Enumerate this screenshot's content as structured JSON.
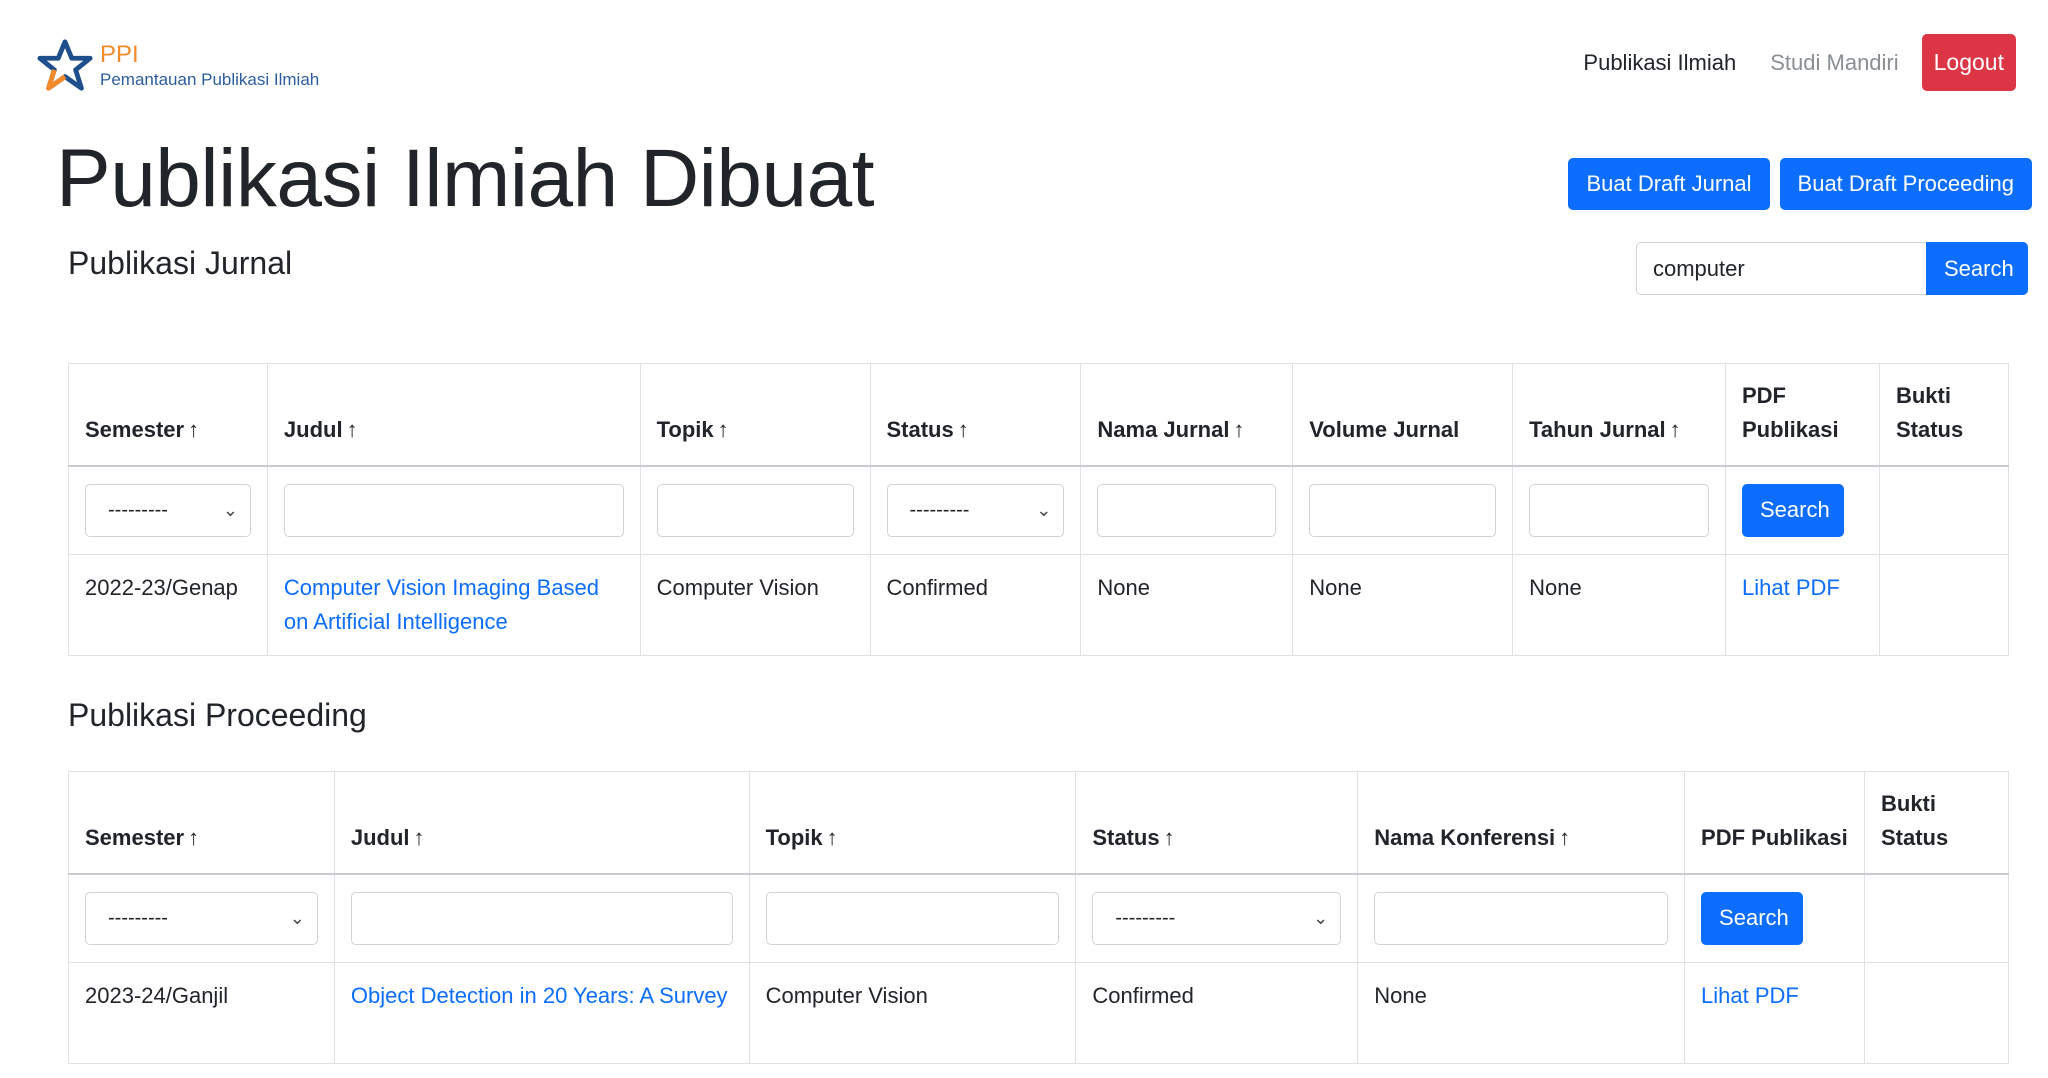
{
  "navbar": {
    "brand_short": "PPI",
    "brand_full": "Pemantauan Publikasi Ilmiah",
    "links": [
      "Publikasi Ilmiah",
      "Studi Mandiri"
    ],
    "logout_label": "Logout"
  },
  "page": {
    "title": "Publikasi Ilmiah Dibuat",
    "btn_draft_jurnal": "Buat Draft Jurnal",
    "btn_draft_proceeding": "Buat Draft Proceeding"
  },
  "search": {
    "value": "computer",
    "button_label": "Search"
  },
  "jurnal": {
    "section_title": "Publikasi Jurnal",
    "headers": [
      "Semester",
      "Judul",
      "Topik",
      "Status",
      "Nama Jurnal",
      "Volume Jurnal",
      "Tahun Jurnal",
      "PDF Publikasi",
      "Bukti Status"
    ],
    "sort_arrow": "↑",
    "filter": {
      "select_placeholder": "---------",
      "status_placeholder": "---------",
      "button_label": "Search"
    },
    "rows": [
      {
        "semester": "2022-23/Genap",
        "judul": "Computer Vision Imaging Based on Artificial Intelligence",
        "topik": "Computer Vision",
        "status": "Confirmed",
        "nama_jurnal": "None",
        "volume_jurnal": "None",
        "tahun_jurnal": "None",
        "pdf": "Lihat PDF",
        "bukti": ""
      }
    ]
  },
  "proceeding": {
    "section_title": "Publikasi Proceeding",
    "headers": [
      "Semester",
      "Judul",
      "Topik",
      "Status",
      "Nama Konferensi",
      "PDF Publikasi",
      "Bukti Status"
    ],
    "sort_arrow": "↑",
    "filter": {
      "select_placeholder": "---------",
      "status_placeholder": "---------",
      "button_label": "Search"
    },
    "rows": [
      {
        "semester": "2023-24/Ganjil",
        "judul": "Object Detection in 20 Years: A Survey",
        "topik": "Computer Vision",
        "status": "Confirmed",
        "nama_konferensi": "None",
        "pdf": "Lihat PDF",
        "bukti": ""
      }
    ]
  },
  "colors": {
    "primary": "#0d6efd",
    "danger": "#dc3545",
    "brand_orange": "#f58a2b",
    "brand_blue": "#2c5d9c"
  },
  "icons": [
    "ppi-star-logo-icon",
    "chevron-down-icon"
  ]
}
